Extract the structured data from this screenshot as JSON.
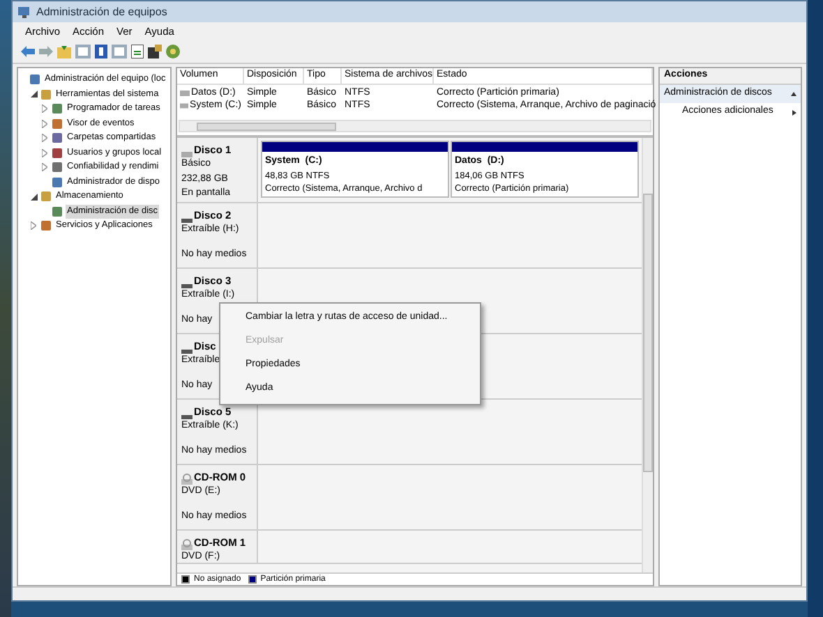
{
  "window": {
    "title": "Administración de equipos"
  },
  "menu": [
    "Archivo",
    "Acción",
    "Ver",
    "Ayuda"
  ],
  "tree": [
    {
      "label": "Administración del equipo (loc",
      "selected": false,
      "children": [
        {
          "label": "Herramientas del sistema",
          "expanded": true,
          "selected": false,
          "children": [
            {
              "label": "Programador de tareas",
              "expanded": false,
              "selected": false
            },
            {
              "label": "Visor de eventos",
              "expanded": false,
              "selected": false
            },
            {
              "label": "Carpetas compartidas",
              "expanded": false,
              "selected": false
            },
            {
              "label": "Usuarios y grupos local",
              "expanded": false,
              "selected": false
            },
            {
              "label": "Confiabilidad y rendimi",
              "expanded": false,
              "selected": false
            },
            {
              "label": "Administrador de dispo",
              "selected": false
            }
          ]
        },
        {
          "label": "Almacenamiento",
          "expanded": true,
          "selected": false,
          "children": [
            {
              "label": "Administración de disc",
              "selected": true
            }
          ]
        },
        {
          "label": "Servicios y Aplicaciones",
          "expanded": false,
          "selected": false
        }
      ]
    }
  ],
  "volumes": {
    "columns": [
      "Volumen",
      "Disposición",
      "Tipo",
      "Sistema de archivos",
      "Estado"
    ],
    "rows": [
      [
        "Datos (D:)",
        "Simple",
        "Básico",
        "NTFS",
        "Correcto (Partición primaria)"
      ],
      [
        "System (C:)",
        "Simple",
        "Básico",
        "NTFS",
        "Correcto (Sistema, Arranque, Archivo de paginació"
      ]
    ]
  },
  "disks": [
    {
      "kind": "disk",
      "name": "Disco 1",
      "lines": [
        "Básico",
        "232,88 GB",
        "En pantalla"
      ],
      "partitions": [
        {
          "name": "System  (C:)",
          "size": "48,83 GB NTFS",
          "status": "Correcto (Sistema, Arranque, Archivo d"
        },
        {
          "name": "Datos  (D:)",
          "size": "184,06 GB NTFS",
          "status": "Correcto (Partición primaria)"
        }
      ]
    },
    {
      "kind": "removable",
      "name": "Disco 2",
      "lines": [
        "Extraíble (H:)",
        "No hay medios"
      ]
    },
    {
      "kind": "removable",
      "name": "Disco 3",
      "lines": [
        "Extraíble (I:)",
        "No hay"
      ]
    },
    {
      "kind": "removable",
      "name": "Disc",
      "lines": [
        "Extraíble",
        "No hay"
      ]
    },
    {
      "kind": "removable",
      "name": "Disco 5",
      "lines": [
        "Extraíble (K:)",
        "No hay medios"
      ]
    },
    {
      "kind": "cdrom",
      "name": "CD-ROM 0",
      "lines": [
        "DVD (E:)",
        "No hay medios"
      ]
    },
    {
      "kind": "cdrom",
      "name": "CD-ROM 1",
      "lines": [
        "DVD (F:)"
      ]
    }
  ],
  "legend": [
    {
      "label": "No asignado",
      "color": "#000000"
    },
    {
      "label": "Partición primaria",
      "color": "#000080"
    }
  ],
  "context_menu": [
    {
      "label": "Cambiar la letra y rutas de acceso de unidad...",
      "disabled": false
    },
    {
      "label": "Expulsar",
      "disabled": true
    },
    {
      "label": "Propiedades",
      "disabled": false
    },
    {
      "label": "Ayuda",
      "disabled": false
    }
  ],
  "actions": {
    "title": "Acciones",
    "section": "Administración de discos",
    "items": [
      "Acciones adicionales"
    ]
  }
}
